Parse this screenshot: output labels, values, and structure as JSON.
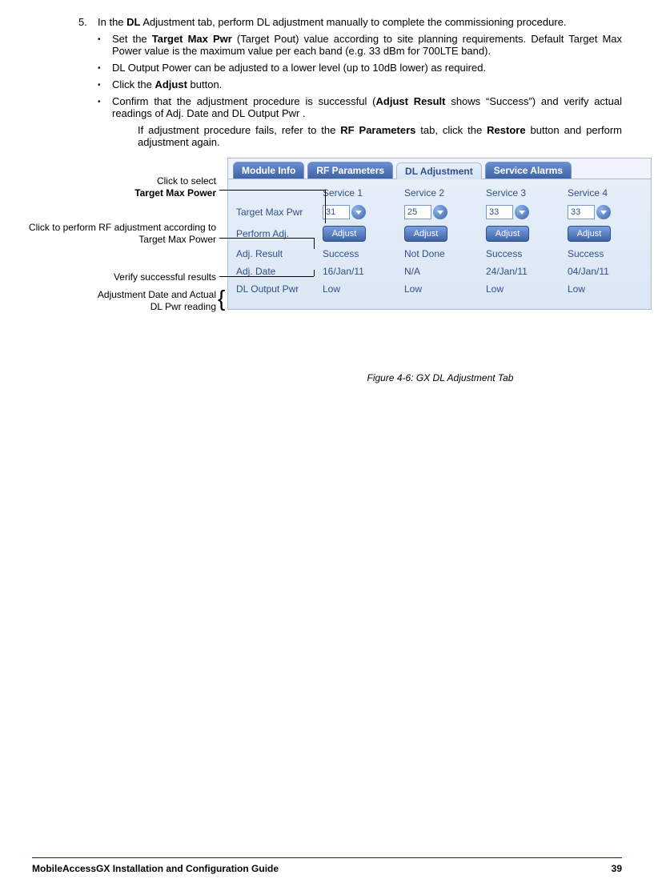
{
  "step": {
    "num": "5.",
    "text_pre": "In the ",
    "text_bold": "DL",
    "text_post": " Adjustment tab, perform DL adjustment manually to complete the commissioning procedure."
  },
  "bullets": [
    {
      "pre": "Set the ",
      "b1": "Target Max Pwr",
      "post": " (Target Pout) value according to site planning requirements. Default Target Max Power value is the maximum value per each band (e.g. 33 dBm for 700LTE band)."
    },
    {
      "plain": "DL Output Power can be adjusted to a lower level (up to 10dB lower) as required."
    },
    {
      "pre": "Click the ",
      "b1": "Adjust",
      "post": " button."
    },
    {
      "pre": "Confirm that the adjustment procedure is successful (",
      "b1": "Adjust Result",
      "post": " shows “Success”) and verify actual readings of Adj. Date and DL Output Pwr ."
    }
  ],
  "sub": {
    "pre": "If adjustment procedure fails, refer to the ",
    "b1": "RF Parameters",
    "mid": " tab, click the ",
    "b2": "Restore",
    "post": " button and perform adjustment again."
  },
  "annotations": {
    "a1_line1": "Click to select",
    "a1_line2": "Target Max Power",
    "a2": "Click to perform RF adjustment according to Target Max Power",
    "a3": "Verify successful results",
    "a4_line1": "Adjustment Date and Actual",
    "a4_line2": "DL Pwr reading"
  },
  "tabs": [
    "Module Info",
    "RF Parameters",
    "DL Adjustment",
    "Service Alarms"
  ],
  "cols": [
    "",
    "Service 1",
    "Service 2",
    "Service 3",
    "Service 4"
  ],
  "rows": {
    "target": {
      "label": "Target Max Pwr",
      "vals": [
        "31",
        "25",
        "33",
        "33"
      ]
    },
    "perform": {
      "label": "Perform Adj.",
      "btn": "Adjust"
    },
    "result": {
      "label": "Adj. Result",
      "vals": [
        "Success",
        "Not Done",
        "Success",
        "Success"
      ]
    },
    "date": {
      "label": "Adj. Date",
      "vals": [
        "16/Jan/11",
        "N/A",
        "24/Jan/11",
        "04/Jan/11"
      ]
    },
    "output": {
      "label": "DL Output Pwr",
      "vals": [
        "Low",
        "Low",
        "Low",
        "Low"
      ]
    }
  },
  "caption": "Figure 4-6: GX DL Adjustment Tab",
  "footer": {
    "title": "MobileAccessGX Installation and Configuration Guide",
    "page": "39"
  }
}
